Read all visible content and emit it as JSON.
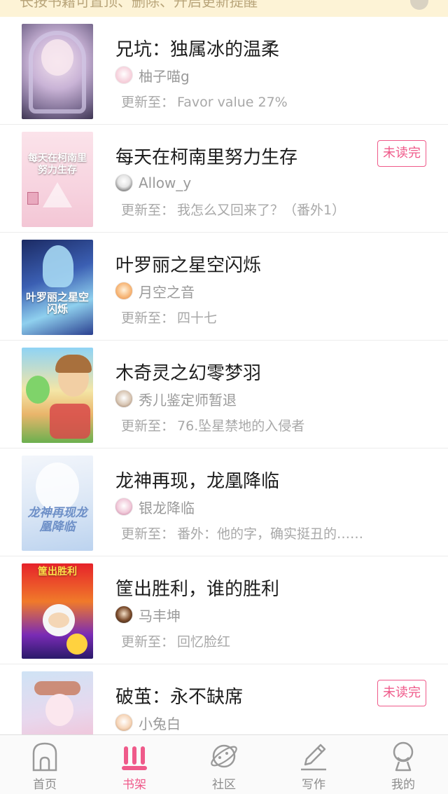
{
  "tip": {
    "text": "长按书籍可置顶、删除、开启更新提醒"
  },
  "books": [
    {
      "title": "兄坑：独属冰的温柔",
      "author": "柚子喵g",
      "update_prefix": "更新至：",
      "update": "Favor value  27%",
      "badge": "",
      "cover_text": ""
    },
    {
      "title": "每天在柯南里努力生存",
      "author": "Allow_y",
      "update_prefix": "更新至：",
      "update": "我怎么又回来了？（番外1）",
      "badge": "未读完",
      "cover_text": "每天在柯南里努力生存"
    },
    {
      "title": "叶罗丽之星空闪烁",
      "author": "月空之音",
      "update_prefix": "更新至：",
      "update": "四十七",
      "badge": "",
      "cover_text": "叶罗丽之星空闪烁"
    },
    {
      "title": "木奇灵之幻零梦羽",
      "author": "秀儿鉴定师暂退",
      "update_prefix": "更新至：",
      "update": "76.坠星禁地的入侵者",
      "badge": "",
      "cover_text": ""
    },
    {
      "title": "龙神再现，龙凰降临",
      "author": "银龙降临",
      "update_prefix": "更新至：",
      "update": "番外：他的字，确实挺丑的……",
      "badge": "",
      "cover_text": "龙神再现龙凰降临"
    },
    {
      "title": "筐出胜利，谁的胜利",
      "author": "马丰坤",
      "update_prefix": "更新至：",
      "update": "回忆脸红",
      "badge": "",
      "cover_text": "筐出胜利"
    },
    {
      "title": "破茧：永不缺席",
      "author": "小兔白",
      "update_prefix": "更新至：",
      "update": "",
      "badge": "未读完",
      "cover_text": ""
    }
  ],
  "tabs": [
    {
      "label": "首页",
      "icon": "home-icon",
      "active": false
    },
    {
      "label": "书架",
      "icon": "bookshelf-icon",
      "active": true
    },
    {
      "label": "社区",
      "icon": "planet-icon",
      "active": false
    },
    {
      "label": "写作",
      "icon": "pen-icon",
      "active": false
    },
    {
      "label": "我的",
      "icon": "profile-icon",
      "active": false
    }
  ],
  "colors": {
    "accent": "#ef5a8a",
    "banner_bg": "#fdf3d6",
    "muted_text": "#a8a8a8"
  }
}
